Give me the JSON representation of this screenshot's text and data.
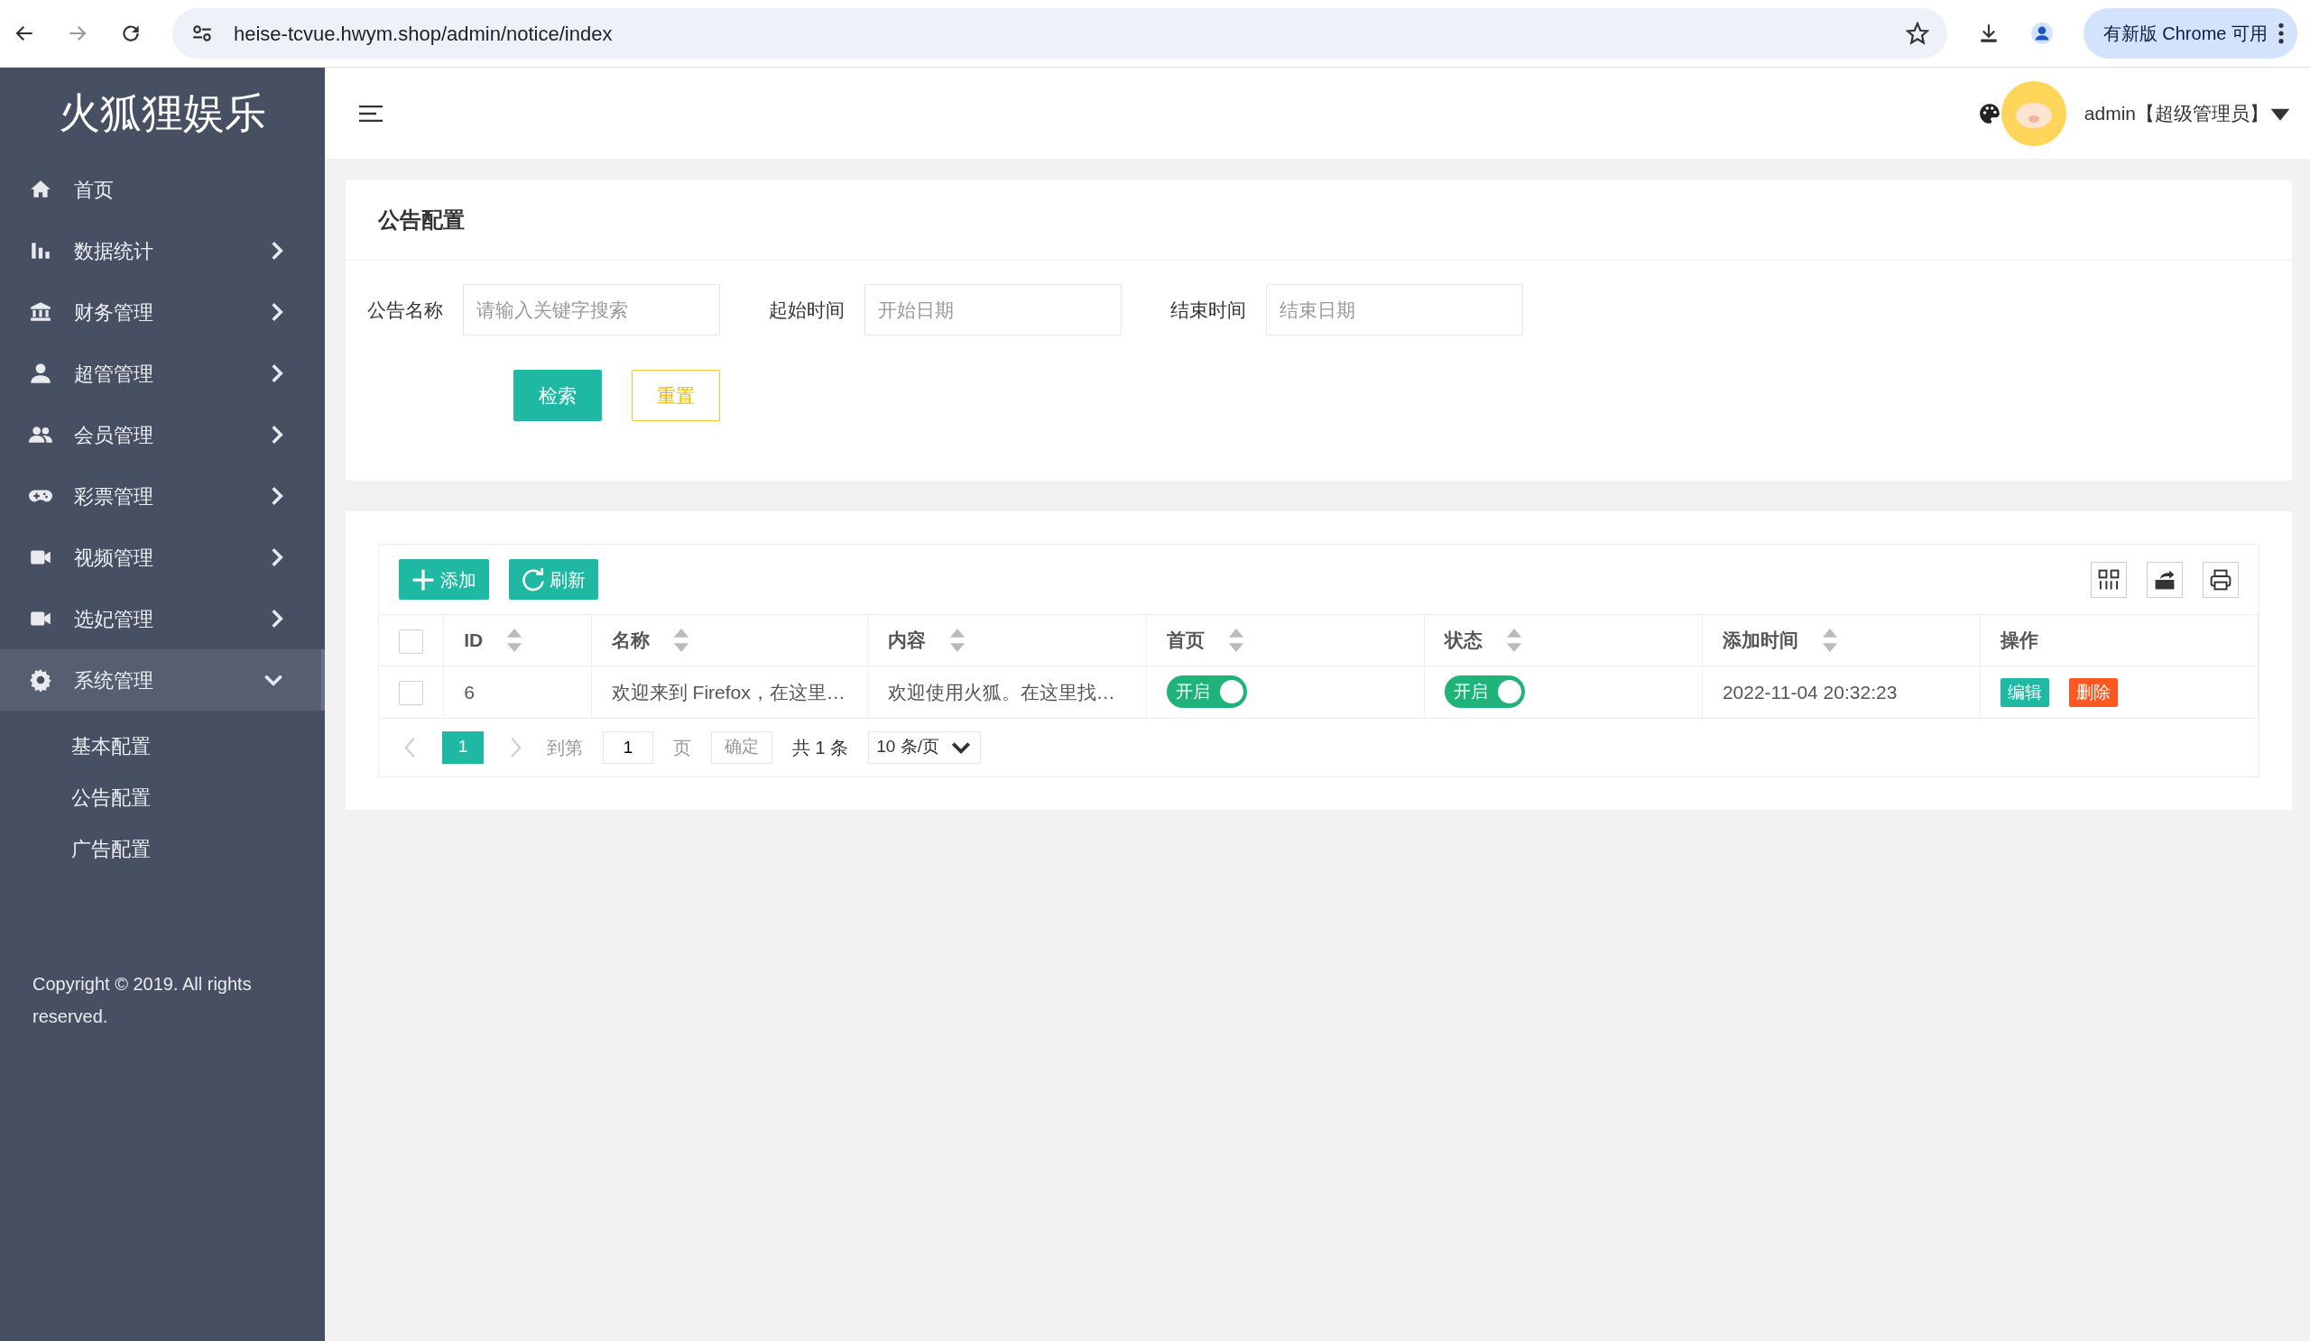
{
  "browser": {
    "url": "heise-tcvue.hwym.shop/admin/notice/index",
    "update_button": "有新版 Chrome 可用"
  },
  "sidebar": {
    "logo": "火狐狸娱乐",
    "items": [
      {
        "label": "首页",
        "has_submenu": false,
        "selected": false
      },
      {
        "label": "数据统计",
        "has_submenu": true,
        "expanded": false,
        "selected": false
      },
      {
        "label": "财务管理",
        "has_submenu": true,
        "expanded": false,
        "selected": false
      },
      {
        "label": "超管管理",
        "has_submenu": true,
        "expanded": false,
        "selected": false
      },
      {
        "label": "会员管理",
        "has_submenu": true,
        "expanded": false,
        "selected": false
      },
      {
        "label": "彩票管理",
        "has_submenu": true,
        "expanded": false,
        "selected": false
      },
      {
        "label": "视频管理",
        "has_submenu": true,
        "expanded": false,
        "selected": false
      },
      {
        "label": "选妃管理",
        "has_submenu": true,
        "expanded": false,
        "selected": false
      },
      {
        "label": "系统管理",
        "has_submenu": true,
        "expanded": true,
        "selected": true,
        "children": [
          {
            "label": "基本配置"
          },
          {
            "label": "公告配置"
          },
          {
            "label": "广告配置"
          }
        ]
      }
    ],
    "copyright": "Copyright © 2019. All rights reserved."
  },
  "header": {
    "user": "admin【超级管理员】"
  },
  "filter": {
    "title": "公告配置",
    "fields": [
      {
        "label": "公告名称",
        "placeholder": "请输入关键字搜索"
      },
      {
        "label": "起始时间",
        "placeholder": "开始日期"
      },
      {
        "label": "结束时间",
        "placeholder": "结束日期"
      }
    ],
    "buttons": [
      {
        "label": "检索",
        "kind": "primary"
      },
      {
        "label": "重置",
        "kind": "outline"
      }
    ]
  },
  "table": {
    "toolbar": [
      {
        "label": "添加",
        "kind": "add"
      },
      {
        "label": "刷新",
        "kind": "refresh"
      }
    ],
    "select_all": {
      "checked": false
    },
    "columns": [
      {
        "label": "ID",
        "sortable": true
      },
      {
        "label": "名称",
        "sortable": true
      },
      {
        "label": "内容",
        "sortable": true
      },
      {
        "label": "首页",
        "sortable": true
      },
      {
        "label": "状态",
        "sortable": true
      },
      {
        "label": "添加时间",
        "sortable": true
      },
      {
        "label": "操作",
        "sortable": false
      }
    ],
    "rows": [
      {
        "checked": false,
        "id": "6",
        "name": "欢迎来到 Firefox，在这里…",
        "content": "欢迎使用火狐。在这里找…",
        "homepage": {
          "label": "开启",
          "on": true
        },
        "status": {
          "label": "开启",
          "on": true
        },
        "added": "2022-11-04 20:32:23",
        "actions": [
          {
            "label": "编辑",
            "kind": "edit"
          },
          {
            "label": "删除",
            "kind": "delete"
          }
        ]
      }
    ],
    "pagination": {
      "pages": [
        {
          "label": "1",
          "selected": true
        }
      ],
      "goto_label": "到第",
      "goto_value": "1",
      "page_label": "页",
      "confirm": "确定",
      "total": "共 1 条",
      "page_size": "10 条/页"
    }
  }
}
